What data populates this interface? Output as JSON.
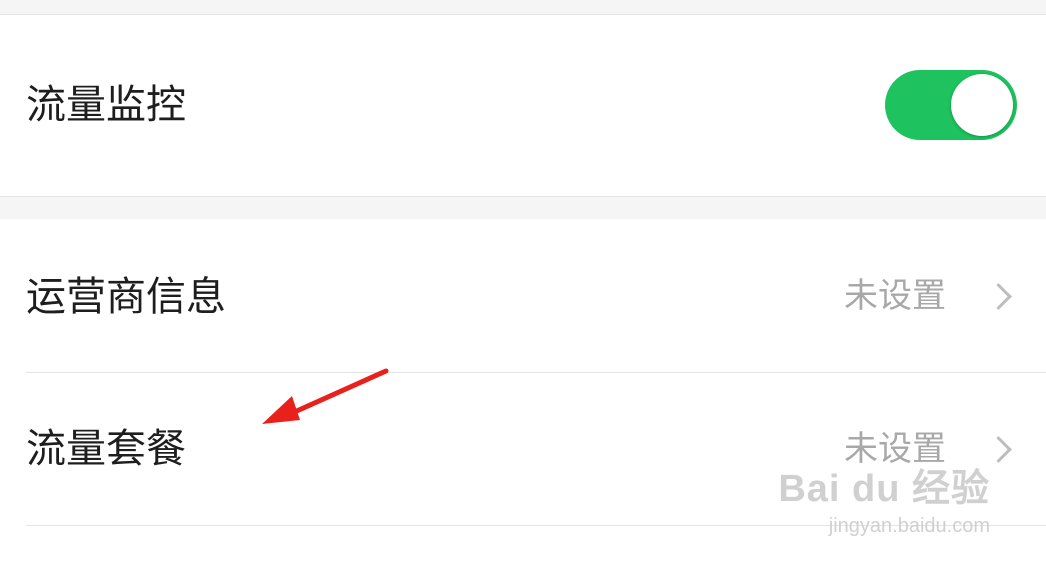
{
  "settings": {
    "monitoring": {
      "label": "流量监控",
      "toggle_on": true,
      "toggle_color": "#1ec25e"
    },
    "carrier": {
      "label": "运营商信息",
      "value": "未设置"
    },
    "plan": {
      "label": "流量套餐",
      "value": "未设置"
    }
  },
  "annotation": {
    "arrow_color": "#e8211c",
    "points_to": "plan"
  },
  "watermark": {
    "brand": "Bai du 经验",
    "url": "jingyan.baidu.com"
  }
}
